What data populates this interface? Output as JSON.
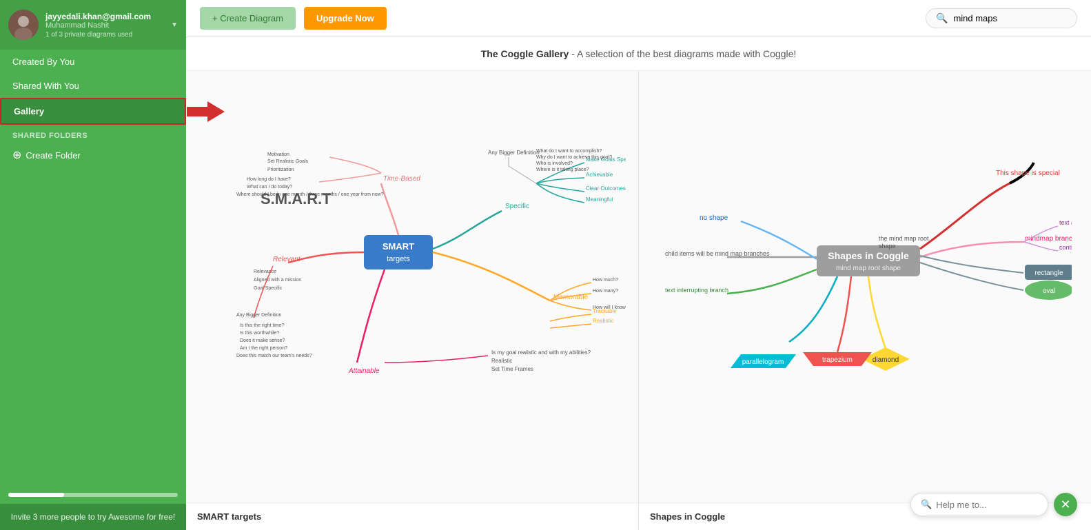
{
  "sidebar": {
    "user": {
      "email": "jayyedali.khan@gmail.com",
      "name": "Muhammad Nashit",
      "diagrams_used": "1 of 3 private diagrams used"
    },
    "nav": [
      {
        "id": "created-by-you",
        "label": "Created By You",
        "active": false
      },
      {
        "id": "shared-with-you",
        "label": "Shared With You",
        "active": false
      },
      {
        "id": "gallery",
        "label": "Gallery",
        "active": true
      }
    ],
    "shared_folders_label": "SHARED FOLDERS",
    "create_folder_label": "Create Folder",
    "invite_text": "Invite 3 more people to try Awesome for free!"
  },
  "topbar": {
    "create_diagram_label": "+ Create Diagram",
    "upgrade_label": "Upgrade Now",
    "search_placeholder": "mind maps",
    "search_value": "mind maps"
  },
  "gallery": {
    "title": "The Coggle Gallery",
    "subtitle": " - A selection of the best diagrams made with Coggle!",
    "cards": [
      {
        "id": "smart-targets",
        "label": "SMART targets"
      },
      {
        "id": "shapes-in-coggle",
        "label": "Shapes in Coggle"
      }
    ]
  },
  "help": {
    "placeholder": "Help me to...",
    "close_icon": "✕"
  },
  "icons": {
    "search": "🔍",
    "plus": "+",
    "folder": "📁",
    "dropdown": "▼"
  }
}
